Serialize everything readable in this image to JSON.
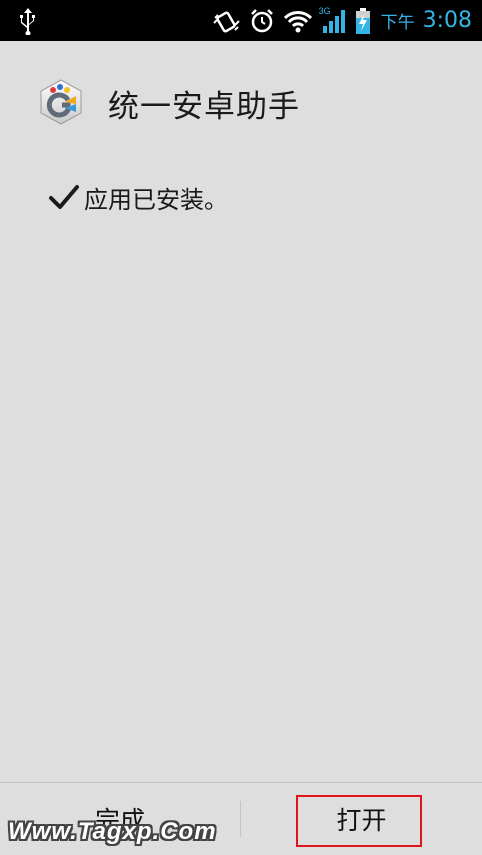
{
  "status_bar": {
    "left_icons": [
      "usb-icon"
    ],
    "right_icons": [
      "vibrate-icon",
      "alarm-icon",
      "wifi-icon",
      "signal-3g-icon",
      "battery-charging-icon"
    ],
    "network_type": "3G",
    "ampm": "下午",
    "time": "3:08",
    "accent_color": "#33b5e5"
  },
  "header": {
    "app_name": "统一安卓助手",
    "app_icon": "app-logo-icon"
  },
  "content": {
    "check_icon": "checkmark-icon",
    "installed_message": "应用已安装。"
  },
  "buttons": {
    "done_label": "完成",
    "open_label": "打开"
  },
  "highlight_color": "#e0141e",
  "watermark": "Www.Tagxp.Com"
}
